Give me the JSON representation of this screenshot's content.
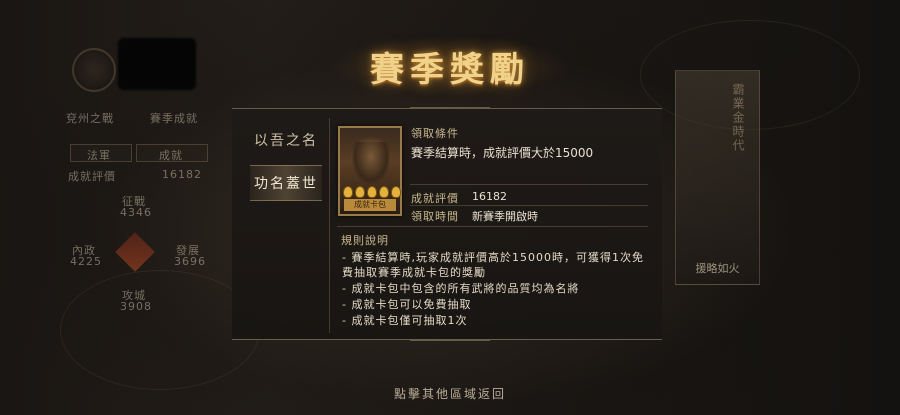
{
  "background": {
    "left": {
      "battle_label": "兗州之戰",
      "season_label": "賽季成就",
      "tabs": [
        "法軍",
        "成就"
      ],
      "score_label": "成就評價",
      "score_value": "16182",
      "stats": [
        {
          "label": "征戰",
          "value": "4346"
        },
        {
          "label": "內政",
          "value": "4225"
        },
        {
          "label": "發展",
          "value": "3696"
        },
        {
          "label": "攻城",
          "value": "3908"
        }
      ]
    },
    "right": {
      "vertical_text": "霸業金時代",
      "tag": "援略如火"
    }
  },
  "modal": {
    "title": "賽季獎勵",
    "tabs": [
      {
        "label": "以吾之名",
        "selected": false
      },
      {
        "label": "功名蓋世",
        "selected": true
      }
    ],
    "card": {
      "plate_text": "成就卡包"
    },
    "condition_label": "領取條件",
    "condition_text": "賽季結算時，成就評價大於15000",
    "score_label": "成就評價",
    "score_value": "16182",
    "time_label": "領取時間",
    "time_value": "新賽季開啟時",
    "rules_title": "規則說明",
    "rules": [
      "- 賽季結算時,玩家成就評價高於15000時，可獲得1次免",
      "  費抽取賽季成就卡包的獎勵",
      "- 成就卡包中包含的所有武將的品質均為名將",
      "- 成就卡包可以免費抽取",
      "- 成就卡包僅可抽取1次"
    ]
  },
  "hint": "點擊其他區域返回",
  "colors": {
    "accent_gold": "#f0d28a",
    "label_gold": "#c8b78e",
    "text_light": "#e8e0d0"
  }
}
